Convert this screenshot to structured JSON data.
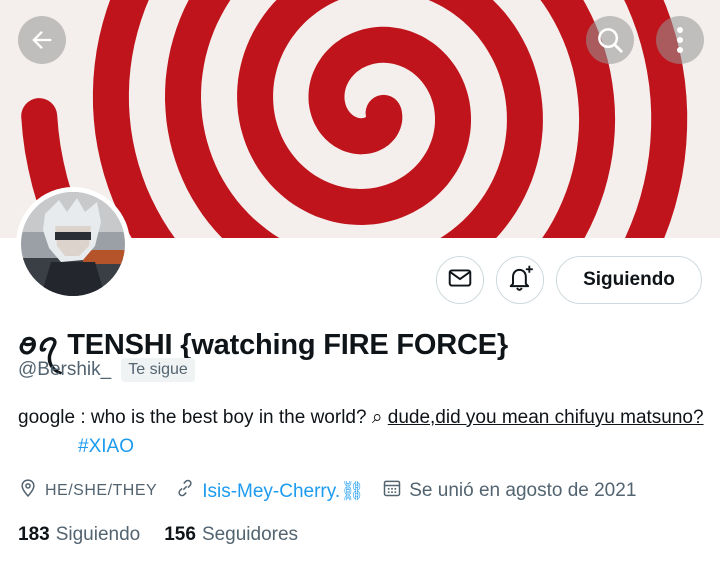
{
  "nav": {
    "back_icon": "arrow-left-icon",
    "search_icon": "search-icon",
    "more_icon": "more-vertical-icon"
  },
  "actions": {
    "message_icon": "envelope-icon",
    "notify_icon": "bell-plus-icon",
    "follow_label": "Siguiendo"
  },
  "profile": {
    "display_name": "ꪮꪖ TENSHI {watching FIRE FORCE}",
    "handle": "@Bershik_",
    "follows_you": "Te sigue",
    "bio_text": "google : who is the best boy in the world? ⌕ ",
    "bio_suggestion": "dude,did you mean chifuyu matsuno?",
    "hashtag": "#XIAO"
  },
  "meta": {
    "pronouns": "HE/SHE/THEY",
    "link": "Isis-Mey-Cherry.⛓",
    "joined": "Se unió en agosto de 2021"
  },
  "stats": {
    "following_count": "183",
    "following_label": "Siguiendo",
    "followers_count": "156",
    "followers_label": "Seguidores"
  },
  "colors": {
    "accent": "#1d9bf0",
    "secondary_text": "#536471",
    "banner_red": "#c0141c"
  }
}
